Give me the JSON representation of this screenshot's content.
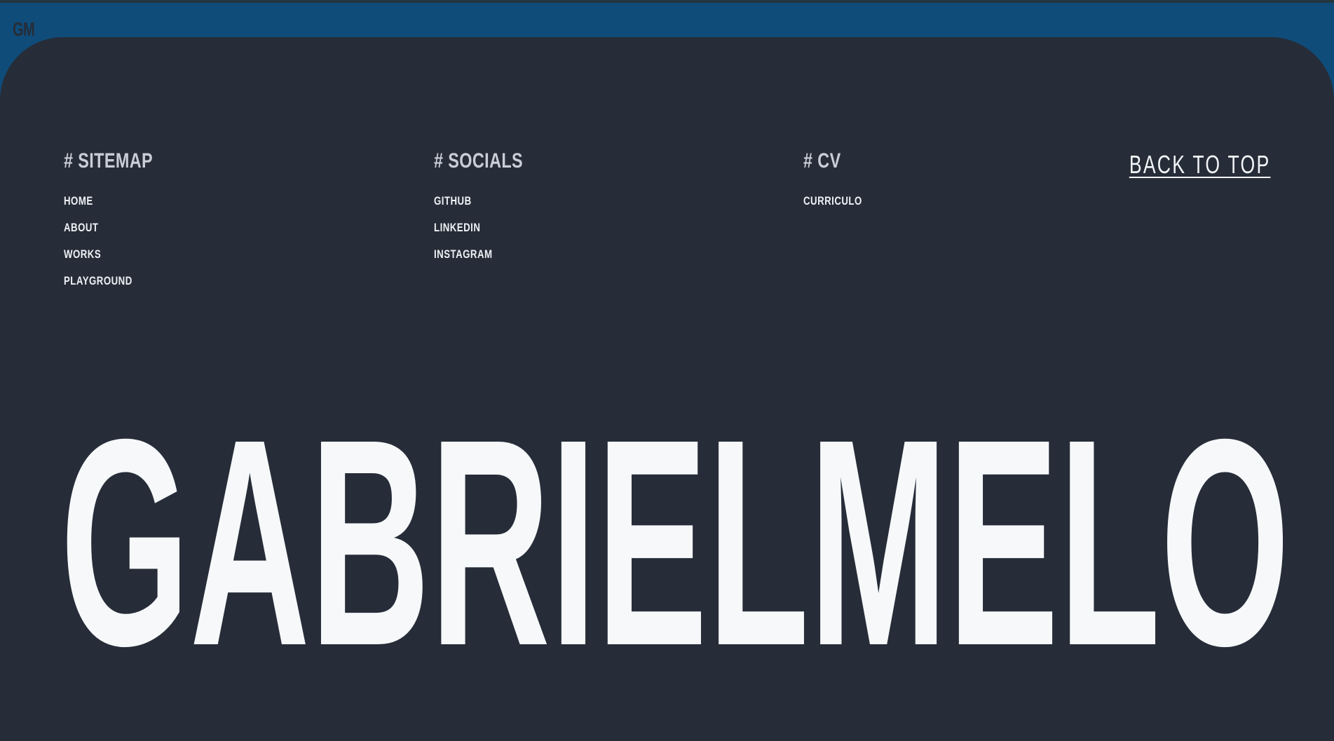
{
  "logo": {
    "text": "GM"
  },
  "footer": {
    "sitemap": {
      "heading": "# SITEMAP",
      "links": [
        "HOME",
        "ABOUT",
        "WORKS",
        "PLAYGROUND"
      ]
    },
    "socials": {
      "heading": "# SOCIALS",
      "links": [
        "GITHUB",
        "LINKEDIN",
        "INSTAGRAM"
      ]
    },
    "cv": {
      "heading": "# CV",
      "links": [
        "CURRICULO"
      ]
    },
    "back_to_top": "BACK TO TOP",
    "big_name": "GABRIELMELO"
  },
  "colors": {
    "page_bg": "#0f4c7a",
    "footer_bg": "#262d38",
    "heading": "#c9ced6",
    "link": "#eef1f5",
    "big_name": "#f6f8fa"
  }
}
